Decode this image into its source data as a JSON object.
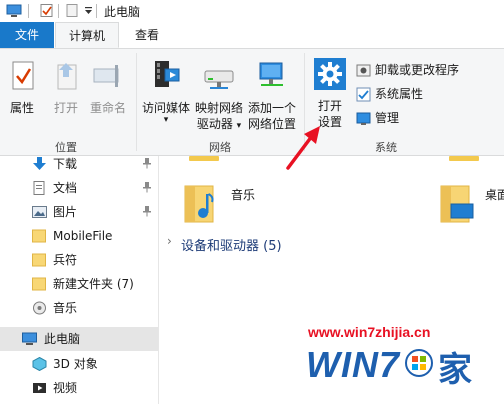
{
  "window": {
    "title": "此电脑"
  },
  "tabs": {
    "file": "文件",
    "computer": "计算机",
    "view": "查看"
  },
  "ribbon": {
    "location": {
      "label": "位置",
      "properties": "属性",
      "open": "打开",
      "rename": "重命名"
    },
    "network": {
      "label": "网络",
      "access_media_l1": "访问媒体",
      "map_drive_l1": "映射网络",
      "map_drive_l2": "驱动器",
      "add_location_l1": "添加一个",
      "add_location_l2": "网络位置"
    },
    "system": {
      "label": "系统",
      "settings_l1": "打开",
      "settings_l2": "设置",
      "uninstall": "卸载或更改程序",
      "sys_props": "系统属性",
      "manage": "管理"
    }
  },
  "nav": {
    "items": [
      {
        "label": "下载",
        "icon": "download-icon",
        "pinned": true
      },
      {
        "label": "文档",
        "icon": "document-icon",
        "pinned": true
      },
      {
        "label": "图片",
        "icon": "picture-icon",
        "pinned": true
      },
      {
        "label": "MobileFile",
        "icon": "folder-icon",
        "pinned": false
      },
      {
        "label": "兵符",
        "icon": "folder-icon",
        "pinned": false
      },
      {
        "label": "新建文件夹 (7)",
        "icon": "folder-icon",
        "pinned": false
      },
      {
        "label": "音乐",
        "icon": "music-icon",
        "pinned": false
      },
      {
        "label": "此电脑",
        "icon": "computer-icon",
        "selected": true
      },
      {
        "label": "3D 对象",
        "icon": "3d-objects-icon",
        "pinned": false
      },
      {
        "label": "视频",
        "icon": "video-icon",
        "pinned": false
      }
    ]
  },
  "content": {
    "music": "音乐",
    "desktop": "桌面",
    "devices_header": "设备和驱动器 (5)"
  },
  "watermark": {
    "url": "www.win7zhijia.cn",
    "logo": "WIN7",
    "logo_suffix": "家"
  },
  "colors": {
    "accent": "#1979ca",
    "selection": "#e5e5e5",
    "arrow": "#e81123",
    "watermark": "#1e5fae"
  }
}
